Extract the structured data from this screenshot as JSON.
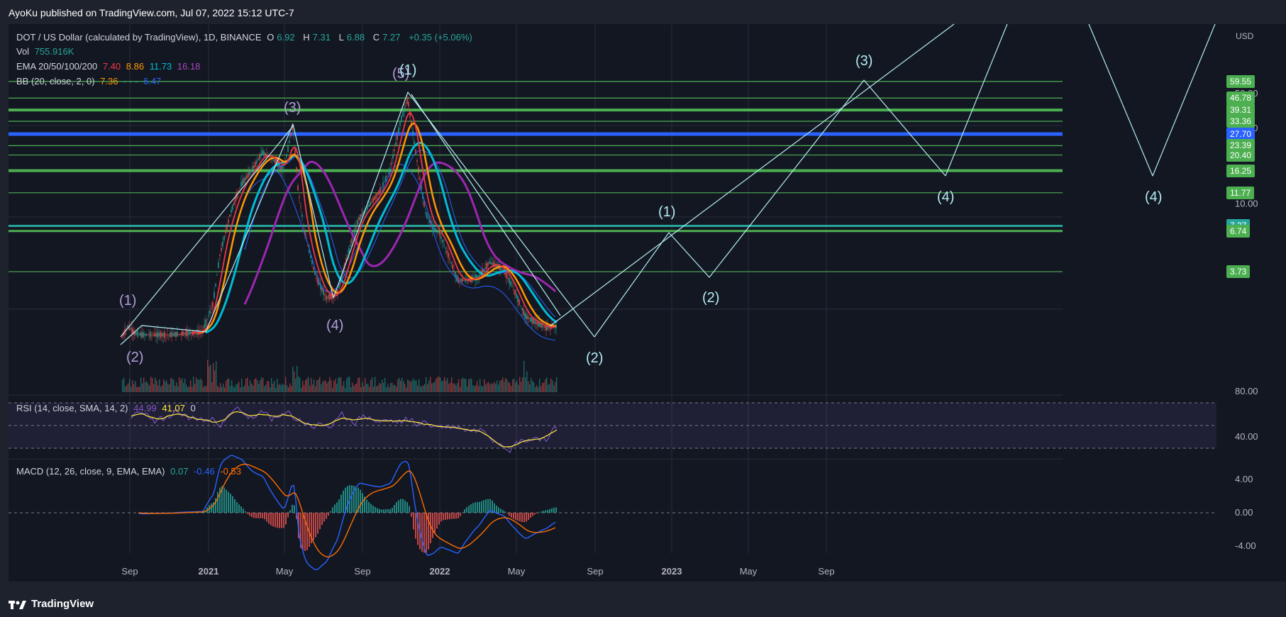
{
  "header": {
    "publish_line": "AyoKu published on TradingView.com, Jul 07, 2022 15:12 UTC-7"
  },
  "brand": {
    "name": "TradingView"
  },
  "price_pane": {
    "title": "DOT / US Dollar (calculated by TradingView), 1D, BINANCE",
    "ohlc": {
      "o_label": "O",
      "o": "6.92",
      "h_label": "H",
      "h": "7.31",
      "l_label": "L",
      "l": "6.88",
      "c_label": "C",
      "c": "7.27",
      "change": "+0.35 (+5.06%)"
    },
    "vol": {
      "label": "Vol",
      "value": "755.916K"
    },
    "ema": {
      "label": "EMA 20/50/100/200",
      "v20": "7.40",
      "v50": "8.86",
      "v100": "11.73",
      "v200": "16.18"
    },
    "bb": {
      "label": "BB (20, close, 2, 0)",
      "basis": "7.36",
      "upper": "- - -",
      "lower": "6.47"
    },
    "currency": "USD",
    "axis_ticks": [
      "50.00",
      "30.00",
      "10.00"
    ]
  },
  "rsi_pane": {
    "label": "RSI (14, close, SMA, 14, 2)",
    "rsi": "44.99",
    "sma": "41.07",
    "extra": "0",
    "ticks": [
      "80.00",
      "40.00"
    ]
  },
  "macd_pane": {
    "label": "MACD (12, 26, close, 9, EMA, EMA)",
    "hist": "0.07",
    "macd": "-0.46",
    "signal": "-0.53",
    "ticks": [
      "4.00",
      "0.00",
      "-4.00"
    ]
  },
  "x_axis": [
    "Sep",
    "2021",
    "May",
    "Sep",
    "2022",
    "May",
    "Sep",
    "2023",
    "May",
    "Sep"
  ],
  "colors": {
    "background": "#1e222d",
    "pane": "#131722",
    "level_green": "#4caf50",
    "level_blue": "#2962ff",
    "wave_line": "#b2ebf2",
    "ema20": "#f23645",
    "ema50": "#ff9800",
    "ema100": "#00bcd4",
    "ema200": "#9c27b0",
    "bb": "#2962ff",
    "rsi": "#7e57c2",
    "rsi_sma": "#ffeb3b"
  },
  "chart_data": {
    "type": "line",
    "instrument": "DOT / US Dollar",
    "interval": "1D",
    "price_levels": [
      {
        "value": "59.55",
        "color": "green"
      },
      {
        "value": "46.78",
        "color": "green"
      },
      {
        "value": "39.31",
        "color": "green"
      },
      {
        "value": "33.36",
        "color": "green"
      },
      {
        "value": "27.70",
        "color": "blue"
      },
      {
        "value": "23.39",
        "color": "green"
      },
      {
        "value": "20.40",
        "color": "green"
      },
      {
        "value": "16.25",
        "color": "green"
      },
      {
        "value": "11.77",
        "color": "green"
      },
      {
        "value": "7.27",
        "color": "teal"
      },
      {
        "value": "6.74",
        "color": "green"
      },
      {
        "value": "3.73",
        "color": "green"
      }
    ],
    "wave_labels": [
      "(1)",
      "(2)",
      "(3)",
      "(4)",
      "(5)",
      "(1)",
      "(2)",
      "(1)",
      "(2)",
      "(3)",
      "(4)",
      "(4)"
    ],
    "rsi_ticks": [
      80,
      40
    ],
    "macd_ticks": [
      4,
      0,
      -4
    ],
    "price_axis_ticks": [
      50,
      30,
      10
    ],
    "grid": true
  }
}
